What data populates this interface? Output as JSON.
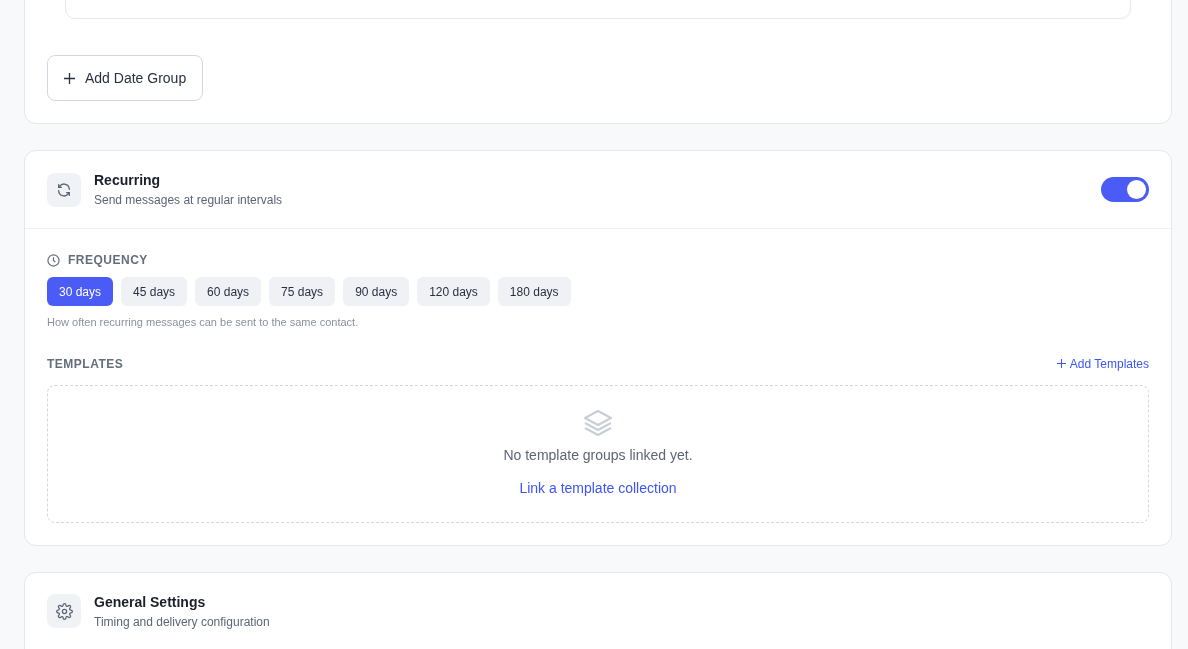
{
  "date_groups": {
    "add_button": "Add Date Group"
  },
  "recurring": {
    "title": "Recurring",
    "subtitle": "Send messages at regular intervals",
    "on": true,
    "frequency": {
      "label": "FREQUENCY",
      "options": [
        {
          "label": "30 days",
          "selected": true
        },
        {
          "label": "45 days",
          "selected": false
        },
        {
          "label": "60 days",
          "selected": false
        },
        {
          "label": "75 days",
          "selected": false
        },
        {
          "label": "90 days",
          "selected": false
        },
        {
          "label": "120 days",
          "selected": false
        },
        {
          "label": "180 days",
          "selected": false
        }
      ],
      "hint": "How often recurring messages can be sent to the same contact."
    },
    "templates": {
      "label": "TEMPLATES",
      "add_link": "Add Templates",
      "empty_text": "No template groups linked yet.",
      "link_text": "Link a template collection"
    }
  },
  "general_settings": {
    "title": "General Settings",
    "subtitle": "Timing and delivery configuration"
  }
}
